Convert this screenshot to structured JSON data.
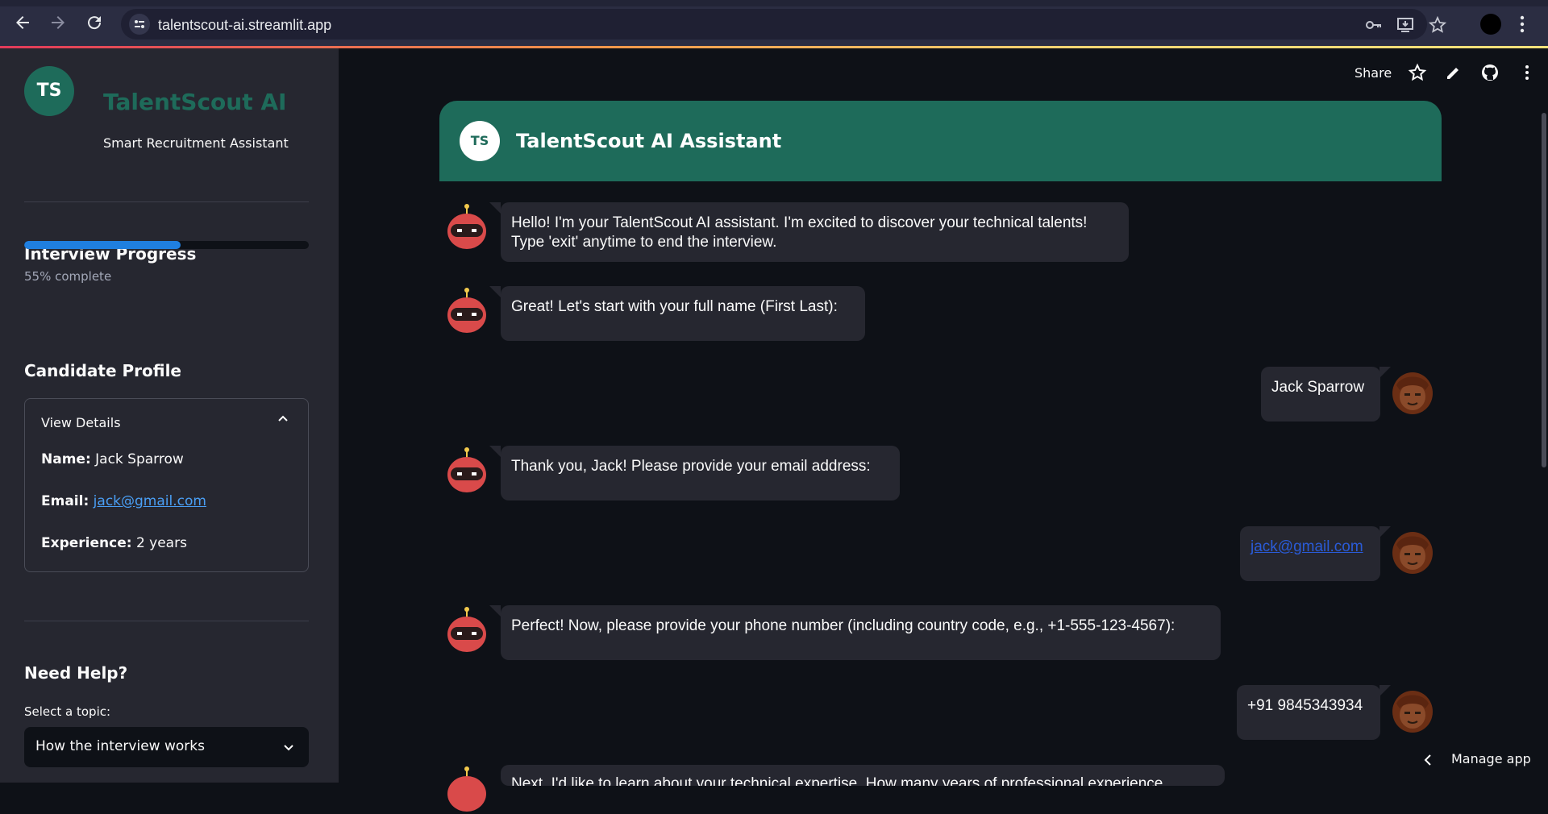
{
  "browser": {
    "url": "talentscout-ai.streamlit.app"
  },
  "sidebar": {
    "logo_initials": "TS",
    "brand_title": "TalentScout AI",
    "brand_subtitle": "Smart Recruitment Assistant",
    "progress_heading": "Interview Progress",
    "progress_fraction": 0.55,
    "progress_text": "55% complete",
    "profile_heading": "Candidate Profile",
    "expander_label": "View Details",
    "profile": {
      "name_label": "Name:",
      "name_value": "Jack Sparrow",
      "email_label": "Email:",
      "email_value": "jack@gmail.com",
      "experience_label": "Experience:",
      "experience_value": "2 years"
    },
    "help_heading": "Need Help?",
    "select_label": "Select a topic:",
    "select_value": "How the interview works"
  },
  "toolbar": {
    "share_label": "Share"
  },
  "chat": {
    "header_initials": "TS",
    "header_title": "TalentScout AI Assistant",
    "messages": [
      {
        "role": "bot",
        "line1": "Hello! I'm your TalentScout AI assistant. I'm excited to discover your technical talents!",
        "line2": "Type 'exit' anytime to end the interview."
      },
      {
        "role": "bot",
        "line1": "Great! Let's start with your full name (First Last):"
      },
      {
        "role": "user",
        "line1": "Jack Sparrow"
      },
      {
        "role": "bot",
        "line1": "Thank you, Jack! Please provide your email address:"
      },
      {
        "role": "user",
        "line1": "jack@gmail.com"
      },
      {
        "role": "bot",
        "line1": "Perfect! Now, please provide your phone number (including country code, e.g., +1-555-123-4567):"
      },
      {
        "role": "user",
        "line1": "+91 9845343934"
      },
      {
        "role": "bot",
        "line1": "Next, I'd like to learn about your technical expertise. How many years of professional experience"
      }
    ]
  },
  "footer": {
    "manage_label": "Manage app"
  },
  "colors": {
    "brand_green": "#1e6b5a",
    "progress_blue": "#1f7fe0",
    "bubble_bg": "#262730",
    "page_bg": "#0e1117"
  }
}
